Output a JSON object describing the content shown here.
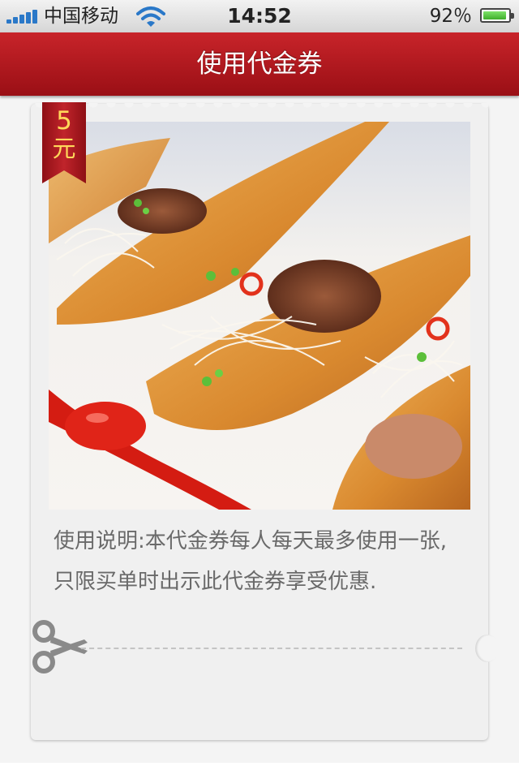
{
  "status_bar": {
    "carrier": "中国移动",
    "time": "14:52",
    "battery_percent": "92％",
    "battery_level": 0.92,
    "signal_icon": "signal-bars-icon",
    "wifi_icon": "wifi-icon",
    "battery_icon": "battery-icon"
  },
  "nav": {
    "title": "使用代金券"
  },
  "coupon": {
    "badge_value": "5",
    "badge_unit": "元",
    "image_description_icon": "food-photo",
    "description": "使用说明:本代金券每人每天最多使用一张,只限买单时出示此代金券享受优惠.",
    "scissors_icon": "scissors-icon"
  },
  "colors": {
    "nav_red": "#b31a20",
    "badge_gold": "#ffd85a",
    "text_gray": "#6a6a6a"
  }
}
